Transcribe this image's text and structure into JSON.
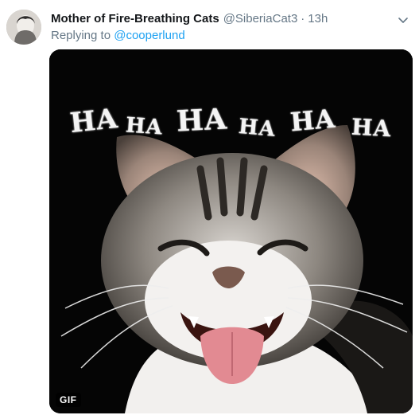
{
  "tweet": {
    "display_name": "Mother of Fire-Breathing Cats",
    "handle": "@SiberiaCat3",
    "separator": "·",
    "time": "13h",
    "reply_prefix": "Replying to",
    "reply_to": "@cooperlund",
    "media": {
      "badge": "GIF",
      "overlay_text": [
        "HA",
        "HA",
        "HA",
        "HA",
        "HA",
        "HA"
      ]
    }
  },
  "icons": {
    "more": "chevron-down-icon",
    "avatar": "avatar"
  },
  "colors": {
    "name": "#14171a",
    "secondary": "#657786",
    "link": "#1da1f2",
    "media_bg": "#050505"
  }
}
